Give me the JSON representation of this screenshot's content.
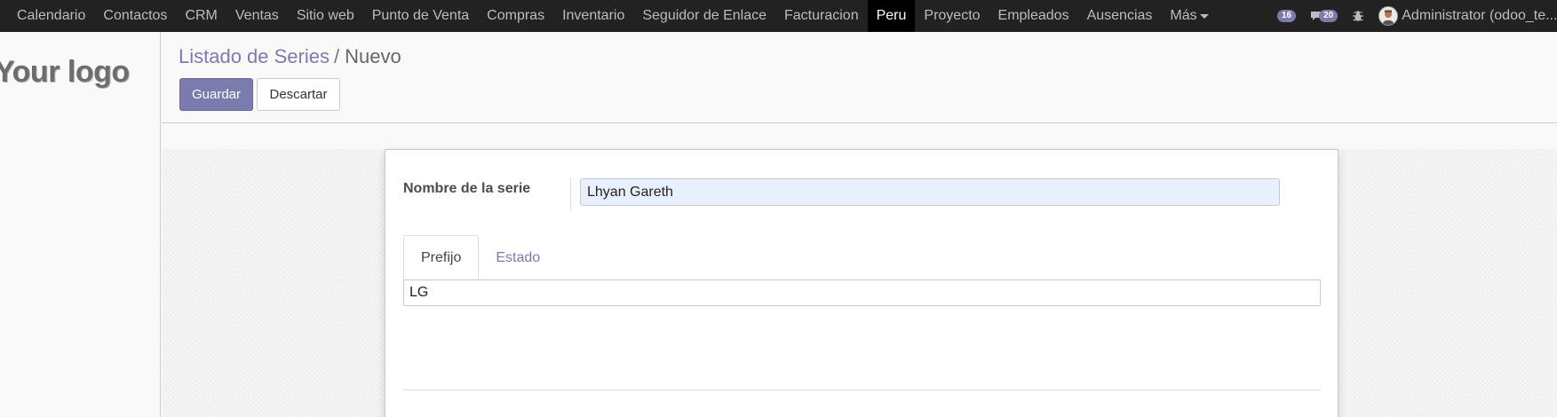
{
  "navbar": {
    "items": [
      {
        "label": "Calendario"
      },
      {
        "label": "Contactos"
      },
      {
        "label": "CRM"
      },
      {
        "label": "Ventas"
      },
      {
        "label": "Sitio web"
      },
      {
        "label": "Punto de Venta"
      },
      {
        "label": "Compras"
      },
      {
        "label": "Inventario"
      },
      {
        "label": "Seguidor de Enlace"
      },
      {
        "label": "Facturacion"
      },
      {
        "label": "Peru"
      },
      {
        "label": "Proyecto"
      },
      {
        "label": "Empleados"
      },
      {
        "label": "Ausencias"
      },
      {
        "label": "Más"
      }
    ],
    "active_item": "Peru",
    "activity_count": "16",
    "message_count": "20",
    "bug_icon": "bug-icon",
    "user_name": "Administrator (odoo_te..."
  },
  "sidebar": {
    "logo_text": "Your logo"
  },
  "control_panel": {
    "breadcrumb_parent": "Listado de Series",
    "breadcrumb_separator": "/",
    "breadcrumb_current": "Nuevo",
    "save_label": "Guardar",
    "discard_label": "Descartar"
  },
  "form": {
    "name_label": "Nombre de la serie",
    "name_value": "Lhyan Gareth",
    "tabs": [
      {
        "label": "Prefijo"
      },
      {
        "label": "Estado"
      }
    ],
    "active_tab": "Prefijo",
    "prefix_value": "LG"
  },
  "colors": {
    "brand": "#7c7bad",
    "navbar_bg": "#222222",
    "input_autofill_bg": "#e8f0fe"
  }
}
